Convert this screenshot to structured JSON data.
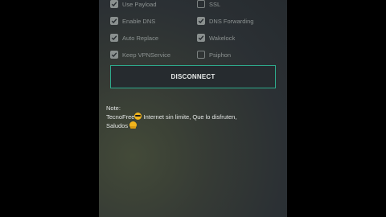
{
  "options": [
    {
      "label": "Use Payload",
      "checked": true
    },
    {
      "label": "SSL",
      "checked": false
    },
    {
      "label": "Enable DNS",
      "checked": true
    },
    {
      "label": "DNS Forwarding",
      "checked": true
    },
    {
      "label": "Auto Replace",
      "checked": true
    },
    {
      "label": "Wakelock",
      "checked": true
    },
    {
      "label": "Keep VPNService",
      "checked": true
    },
    {
      "label": "Psiphon",
      "checked": false
    }
  ],
  "disconnect_button": {
    "label": "DISCONNECT"
  },
  "note": {
    "heading": "Note:",
    "line1_part1": "TecnoFree",
    "line1_part2": " Internet sin limite, Que lo disfruten,",
    "line2": "Saludos",
    "emoji_1": "smiling-face-with-sunglasses",
    "emoji_2": "folded-hands"
  },
  "colors": {
    "accent_border": "#2ea98b",
    "panel_bg": "#2b3034",
    "backdrop": "#000000"
  }
}
